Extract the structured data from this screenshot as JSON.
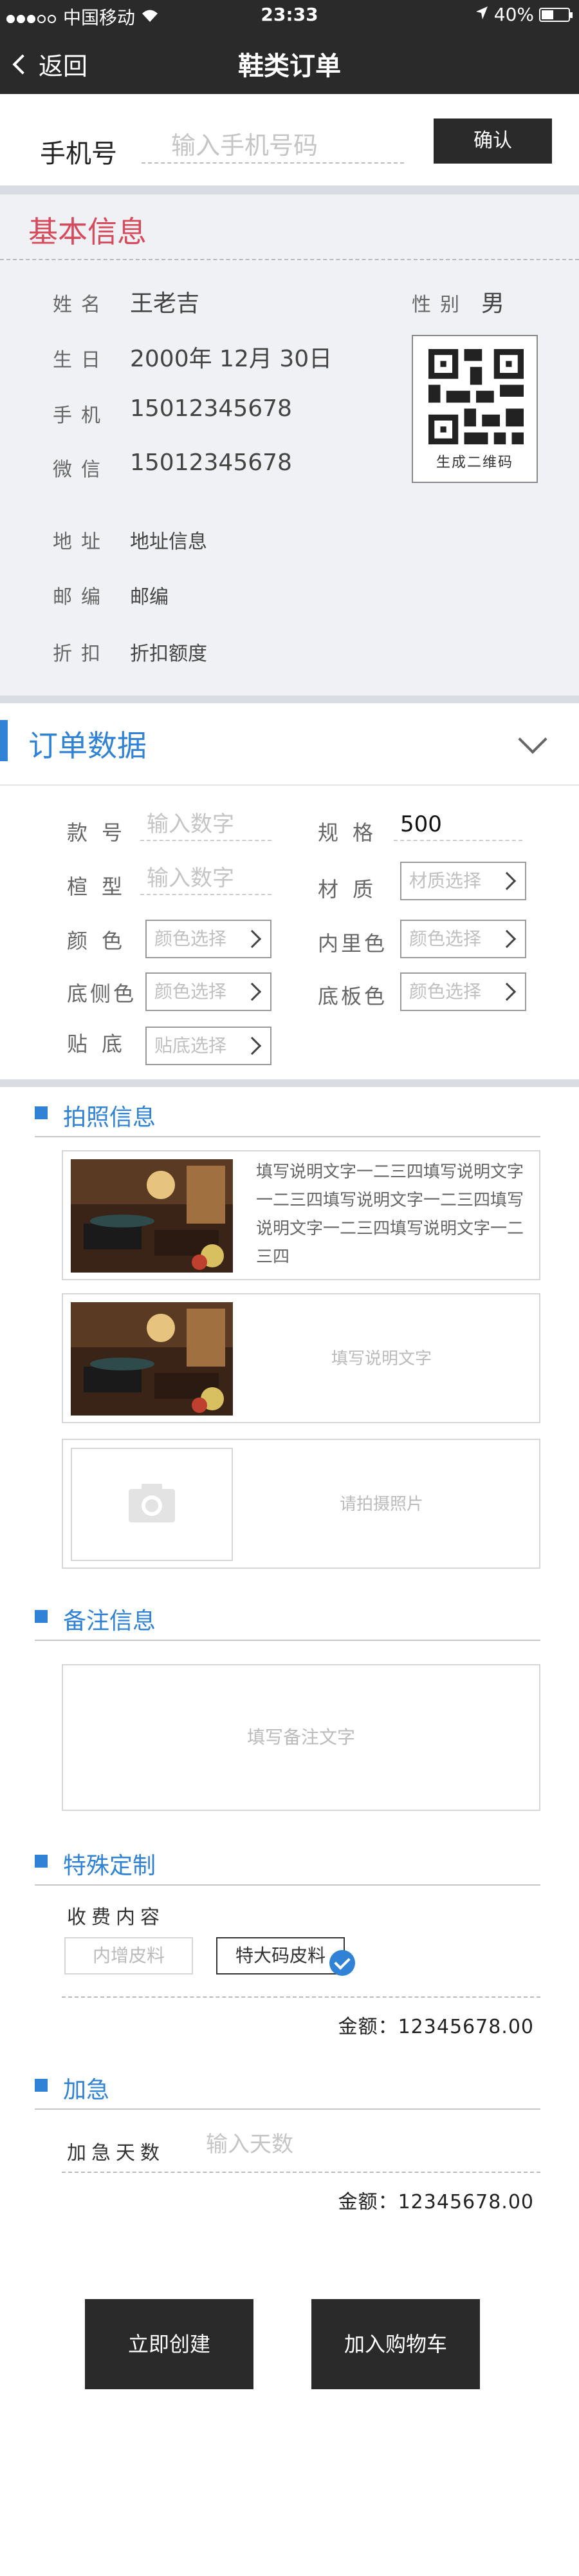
{
  "status_bar": {
    "carrier": "中国移动",
    "time": "23:33",
    "battery": "40%"
  },
  "nav": {
    "back_label": "返回",
    "title": "鞋类订单"
  },
  "phone": {
    "label": "手机号",
    "placeholder": "输入手机号码",
    "confirm_label": "确认"
  },
  "basic_info": {
    "title": "基本信息",
    "name_label": "姓名",
    "name_value": "王老吉",
    "gender_label": "性别",
    "gender_value": "男",
    "birthday_label": "生日",
    "birthday_value": "2000年 12月 30日",
    "mobile_label": "手机",
    "mobile_value": "15012345678",
    "wechat_label": "微信",
    "wechat_value": "15012345678",
    "qr_label": "生成二维码",
    "address_label": "地址",
    "address_value": "地址信息",
    "postcode_label": "邮编",
    "postcode_value": "邮编",
    "discount_label": "折扣",
    "discount_value": "折扣额度"
  },
  "order_data": {
    "title": "订单数据",
    "style_no_label": "款号",
    "style_no_placeholder": "输入数字",
    "spec_label": "规格",
    "spec_value": "500",
    "last_label": "楦型",
    "last_placeholder": "输入数字",
    "material_label": "材质",
    "material_placeholder": "材质选择",
    "color_label": "颜色",
    "color_placeholder": "颜色选择",
    "lining_label": "内里色",
    "lining_placeholder": "颜色选择",
    "sole_side_label": "底侧色",
    "sole_side_placeholder": "颜色选择",
    "sole_board_label": "底板色",
    "sole_board_placeholder": "颜色选择",
    "insole_label": "贴底",
    "insole_placeholder": "贴底选择"
  },
  "photo_info": {
    "title": "拍照信息",
    "cards": [
      {
        "desc": "填写说明文字一二三四填写说明文字一二三四填写说明文字一二三四填写说明文字一二三四填写说明文字一二三四"
      },
      {
        "desc": "填写说明文字"
      },
      {
        "desc": "请拍摄照片"
      }
    ]
  },
  "remark_info": {
    "title": "备注信息",
    "placeholder": "填写备注文字"
  },
  "special": {
    "title": "特殊定制",
    "fee_label": "收费内容",
    "chip_1": "内增皮料",
    "chip_2": "特大码皮料",
    "amount": "金额：12345678.00"
  },
  "urgent": {
    "title": "加急",
    "days_label": "加急天数",
    "days_placeholder": "输入天数",
    "amount": "金额：12345678.00"
  },
  "actions": {
    "create_label": "立即创建",
    "cart_label": "加入购物车"
  },
  "colors": {
    "dark": "#2a2a2a",
    "accent_red": "#d74a5b",
    "accent_blue": "#2f82d6",
    "panel_gray": "#f0f1f4"
  }
}
